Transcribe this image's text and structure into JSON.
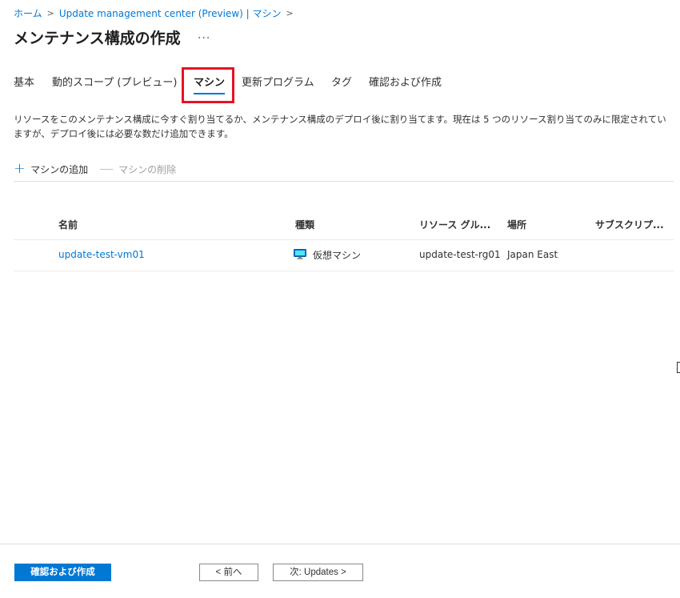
{
  "breadcrumb": {
    "items": [
      "ホーム",
      "Update management center (Preview) | マシン"
    ]
  },
  "header": {
    "title": "メンテナンス構成の作成",
    "more": "..."
  },
  "tabs": [
    "基本",
    "動的スコープ (プレビュー)",
    "マシン",
    "更新プログラム",
    "タグ",
    "確認および作成"
  ],
  "active_tab": "マシン",
  "description": "リソースをこのメンテナンス構成に今すぐ割り当てるか、メンテナンス構成のデプロイ後に割り当てます。現在は 5 つのリソース割り当てのみに限定されていますが、デプロイ後には必要な数だけ追加できます。",
  "toolbar": {
    "add_label": "マシンの追加",
    "remove_label": "マシンの削除"
  },
  "table": {
    "columns": [
      "名前",
      "種類",
      "リソース グル...",
      "場所",
      "サブスクリプ..."
    ],
    "rows": [
      {
        "name": "update-test-vm01",
        "type": "仮想マシン",
        "resource_group": "update-test-rg01",
        "location": "Japan East",
        "subscription": ""
      }
    ]
  },
  "footer": {
    "primary_label": "確認および作成",
    "prev_label": "< 前へ",
    "next_label": "次: Updates >"
  },
  "colors": {
    "accent": "#0078d4",
    "highlight": "#e81123"
  },
  "icons": {
    "add": "plus-icon",
    "remove": "minus-icon",
    "vm": "virtual-machine-icon",
    "more": "ellipsis-icon"
  }
}
